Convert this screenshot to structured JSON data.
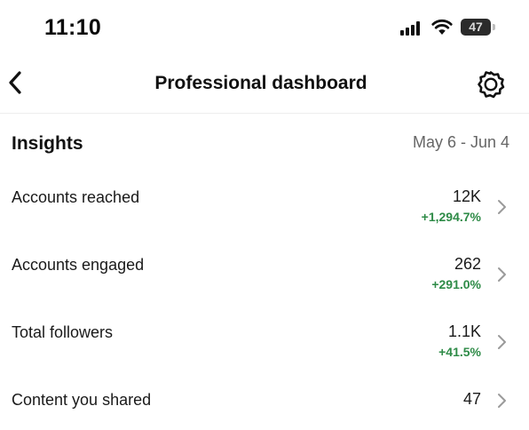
{
  "status_bar": {
    "time": "11:10",
    "battery_level": "47",
    "signal_icon": "cellular-signal-icon",
    "wifi_icon": "wifi-icon"
  },
  "nav": {
    "back_icon": "chevron-left-icon",
    "title": "Professional dashboard",
    "settings_icon": "gear-icon"
  },
  "insights": {
    "title": "Insights",
    "date_range": "May 6 - Jun 4",
    "rows": [
      {
        "label": "Accounts reached",
        "value": "12K",
        "change": "+1,294.7%"
      },
      {
        "label": "Accounts engaged",
        "value": "262",
        "change": "+291.0%"
      },
      {
        "label": "Total followers",
        "value": "1.1K",
        "change": "+41.5%"
      },
      {
        "label": "Content you shared",
        "value": "47",
        "change": ""
      }
    ]
  },
  "colors": {
    "positive_change": "#2e8b47",
    "secondary_text": "#666666",
    "primary_text": "#111111",
    "chevron": "#9a9a9a"
  }
}
